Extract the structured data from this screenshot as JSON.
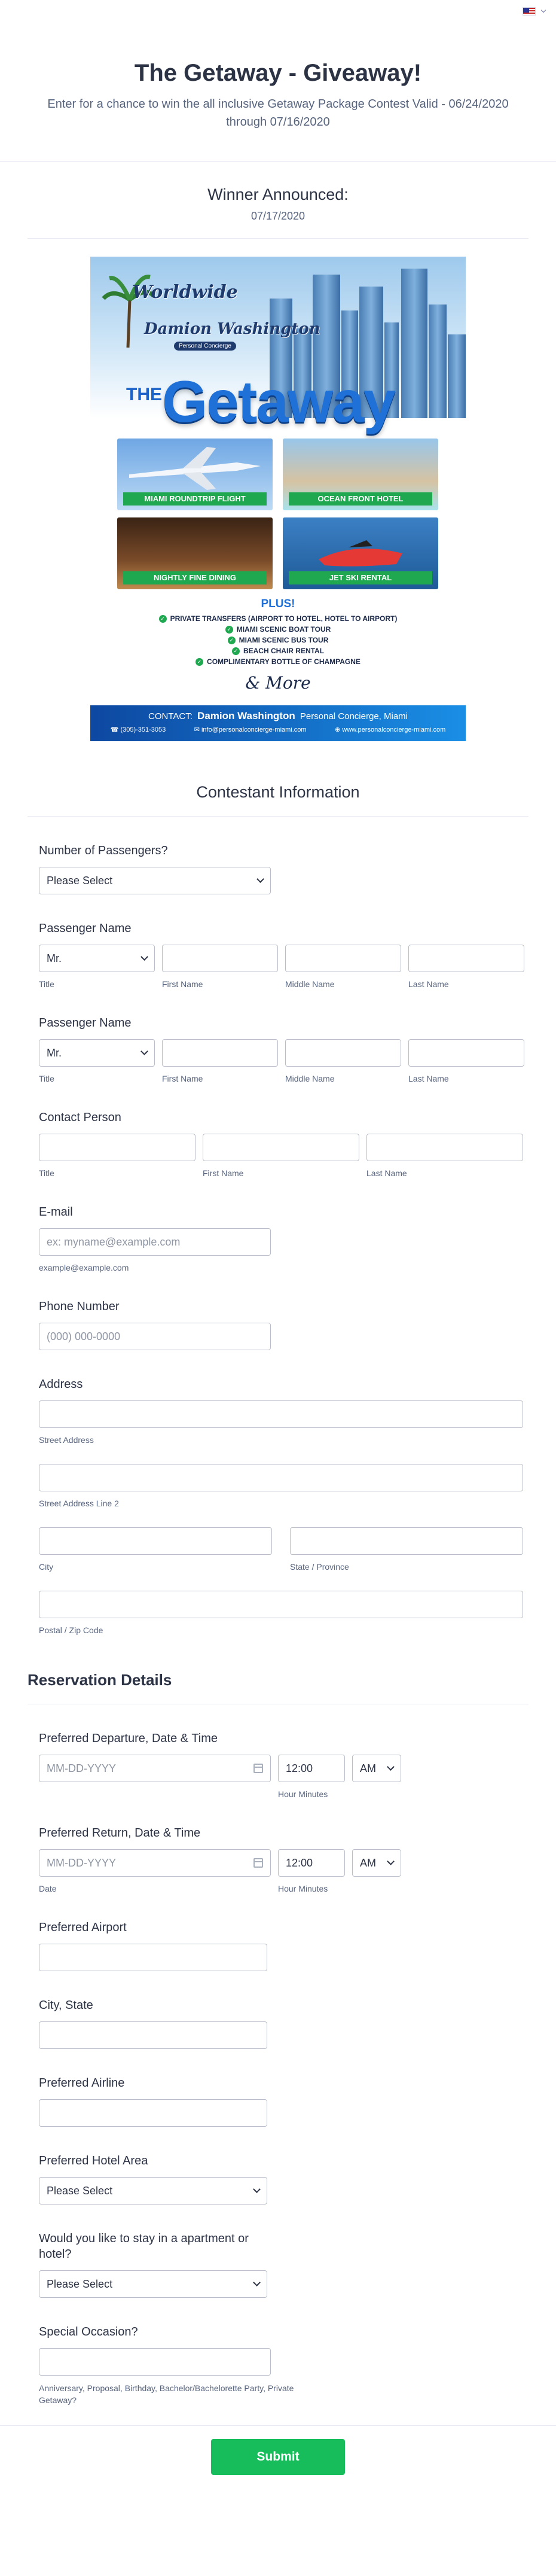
{
  "header": {
    "title": "The Getaway - Giveaway!",
    "subtitle": "Enter for a chance to win the all inclusive Getaway Package Contest Valid - 06/24/2020 through 07/16/2020"
  },
  "winner": {
    "title": "Winner Announced:",
    "date": "07/17/2020"
  },
  "promo": {
    "brand_line1": "Worldwide",
    "brand_line2": "Damion Washington",
    "brand_tag": "Personal Concierge",
    "the": "THE",
    "getaway": "Getaway",
    "tiles": [
      "MIAMI ROUNDTRIP FLIGHT",
      "OCEAN FRONT HOTEL",
      "NIGHTLY FINE DINING",
      "JET SKI RENTAL"
    ],
    "plus": "PLUS!",
    "perks": [
      "PRIVATE TRANSFERS (AIRPORT TO HOTEL, HOTEL TO AIRPORT)",
      "MIAMI SCENIC BOAT TOUR",
      "MIAMI SCENIC BUS TOUR",
      "BEACH CHAIR RENTAL",
      "COMPLIMENTARY BOTTLE OF CHAMPAGNE"
    ],
    "more": "& More",
    "contact_prefix": "CONTACT:",
    "contact_name": "Damion Washington",
    "contact_role": "Personal Concierge, Miami",
    "phone": "(305)-351-3053",
    "email": "info@personalconcierge-miami.com",
    "web": "www.personalconcierge-miami.com"
  },
  "contestant": {
    "title": "Contestant Information",
    "passengers": {
      "label": "Number of Passengers?",
      "value": "Please Select"
    },
    "passenger1": {
      "label": "Passenger Name",
      "title_value": "Mr.",
      "sublabels": [
        "Title",
        "First Name",
        "Middle Name",
        "Last Name"
      ]
    },
    "passenger2": {
      "label": "Passenger Name",
      "title_value": "Mr.",
      "sublabels": [
        "Title",
        "First Name",
        "Middle Name",
        "Last Name"
      ]
    },
    "contact": {
      "label": "Contact Person",
      "sublabels": [
        "Title",
        "First Name",
        "Last Name"
      ]
    },
    "email": {
      "label": "E-mail",
      "placeholder": "ex: myname@example.com",
      "sublabel": "example@example.com"
    },
    "phone": {
      "label": "Phone Number",
      "placeholder": "(000) 000-0000"
    },
    "address": {
      "label": "Address",
      "street": "Street Address",
      "street2": "Street Address Line 2",
      "city": "City",
      "state": "State / Province",
      "postal": "Postal / Zip Code"
    }
  },
  "reservation": {
    "title": "Reservation Details",
    "departure": {
      "label": "Preferred Departure, Date & Time",
      "date_placeholder": "MM-DD-YYYY",
      "time": "12:00",
      "ampm": "AM",
      "sublabel_date": "",
      "sublabel_time": "Hour Minutes"
    },
    "return": {
      "label": "Preferred Return, Date & Time",
      "date_placeholder": "MM-DD-YYYY",
      "time": "12:00",
      "ampm": "AM",
      "sublabel_date": "Date",
      "sublabel_time": "Hour Minutes"
    },
    "airport": {
      "label": "Preferred Airport"
    },
    "city_state": {
      "label": "City, State"
    },
    "airline": {
      "label": "Preferred Airline"
    },
    "hotel_area": {
      "label": "Preferred Hotel Area",
      "value": "Please Select"
    },
    "stay": {
      "label": "Would you like to stay in a apartment or hotel?",
      "value": "Please Select"
    },
    "occasion": {
      "label": "Special Occasion?",
      "note": "Anniversary, Proposal, Birthday, Bachelor/Bachelorette Party, Private Getaway?"
    }
  },
  "submit_label": "Submit",
  "colors": {
    "submit": "#18bd5b",
    "brand_blue": "#1f71d8",
    "tile_label": "#1fa84f"
  }
}
